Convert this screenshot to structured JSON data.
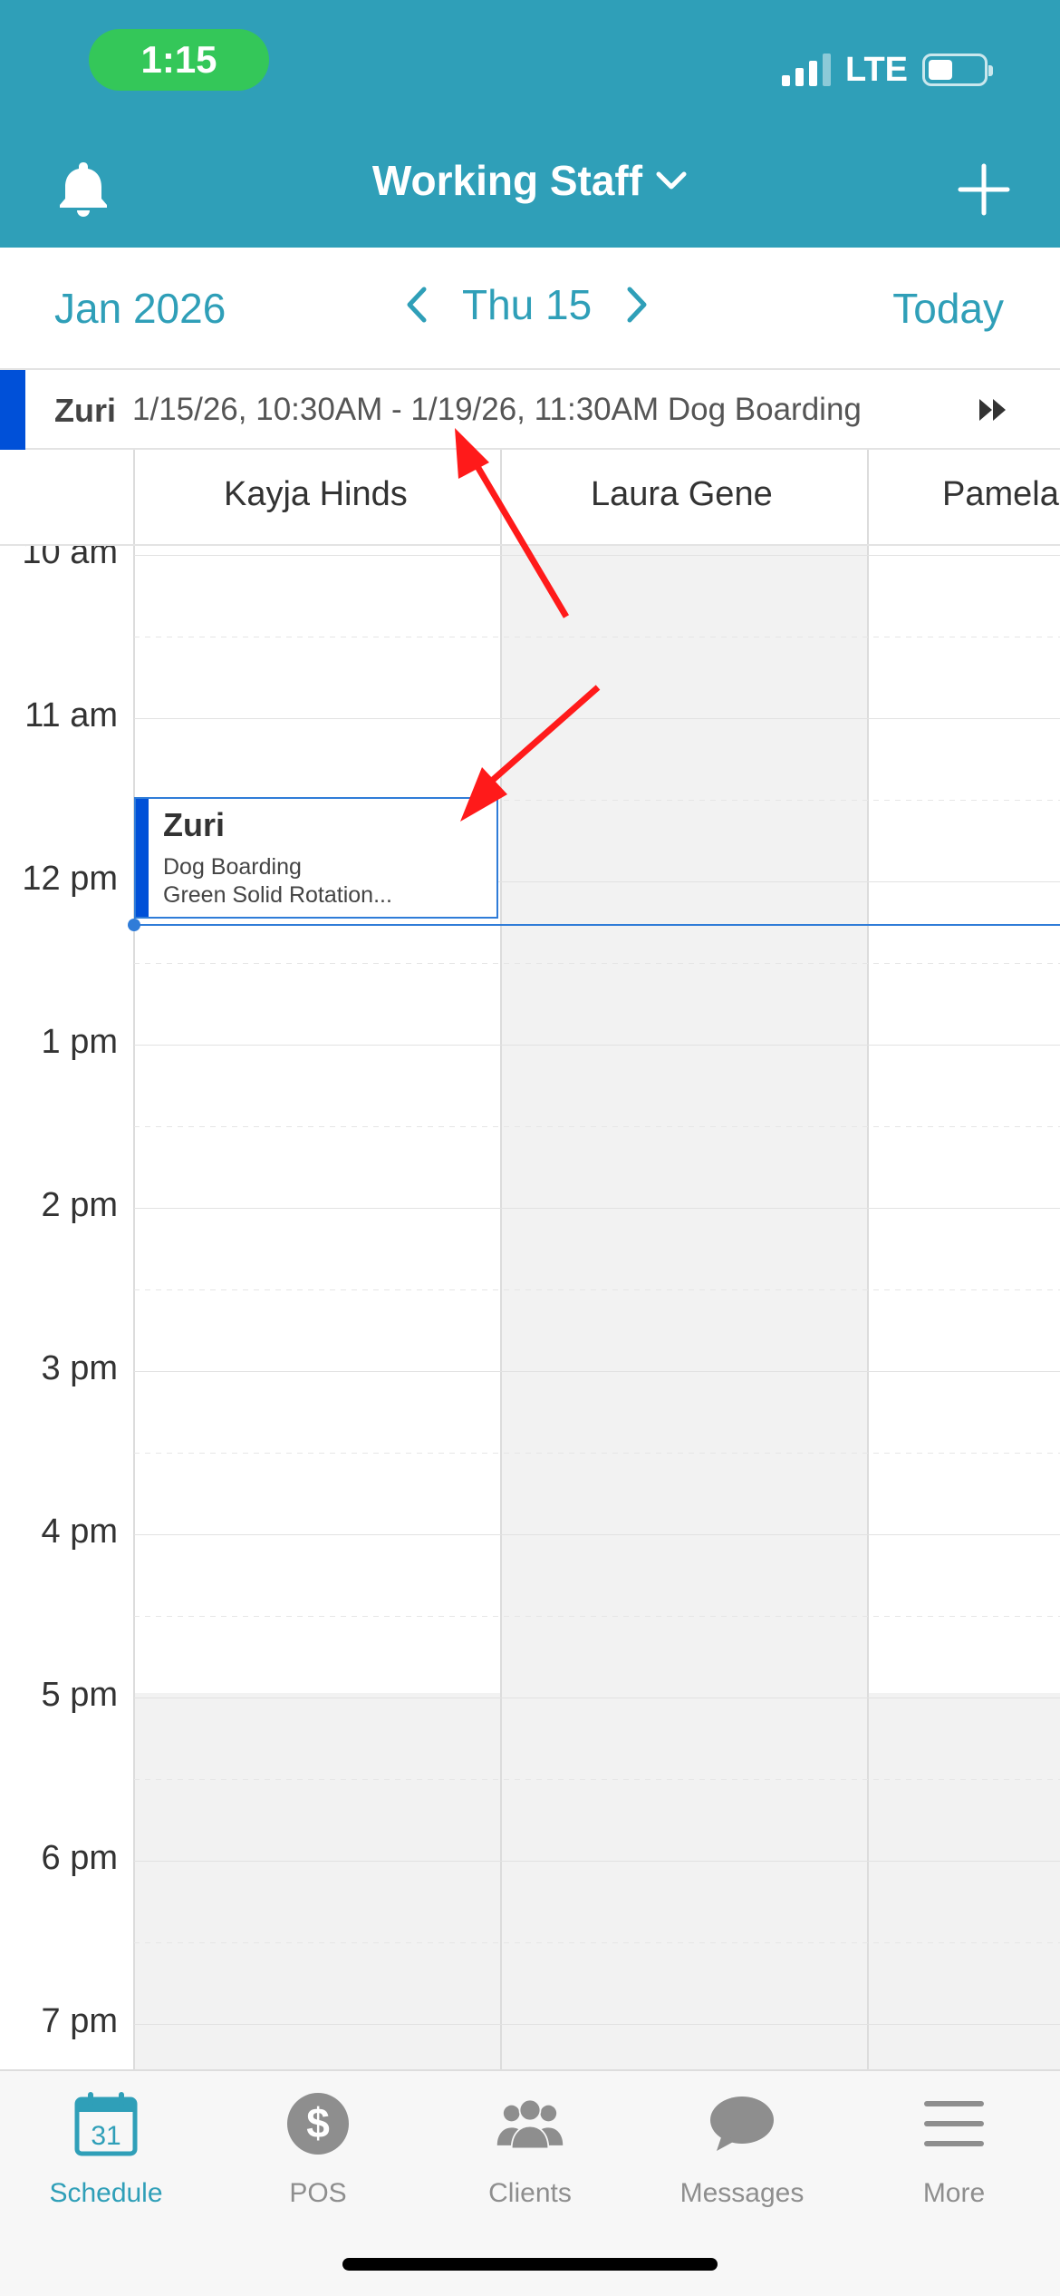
{
  "status_bar": {
    "time": "1:15",
    "network": "LTE"
  },
  "header": {
    "title": "Working Staff",
    "icons": [
      "bell-icon",
      "chevron-down-icon",
      "plus-icon"
    ]
  },
  "date_bar": {
    "month": "Jan 2026",
    "day": "Thu 15",
    "today_label": "Today"
  },
  "banner": {
    "name": "Zuri",
    "details": "1/15/26, 10:30AM - 1/19/26, 11:30AM Dog Boarding",
    "accent_color": "#0050d8"
  },
  "staff": [
    "Kayja Hinds",
    "Laura Gene",
    "Pamela"
  ],
  "hours": [
    "10 am",
    "11 am",
    "12 pm",
    "1 pm",
    "2 pm",
    "3 pm",
    "4 pm",
    "5 pm",
    "6 pm",
    "7 pm"
  ],
  "event": {
    "title": "Zuri",
    "service": "Dog Boarding",
    "note": "Green Solid Rotation..."
  },
  "tabs": [
    {
      "label": "Schedule",
      "icon": "calendar-icon",
      "calendar_day": "31",
      "active": true
    },
    {
      "label": "POS",
      "icon": "dollar-icon",
      "active": false
    },
    {
      "label": "Clients",
      "icon": "clients-icon",
      "active": false
    },
    {
      "label": "Messages",
      "icon": "chat-bubble-icon",
      "active": false
    },
    {
      "label": "More",
      "icon": "menu-icon",
      "active": false
    }
  ],
  "colors": {
    "brand": "#2f9fb8",
    "event_accent": "#0050d8",
    "annotation_arrow": "#ff1a1a"
  }
}
